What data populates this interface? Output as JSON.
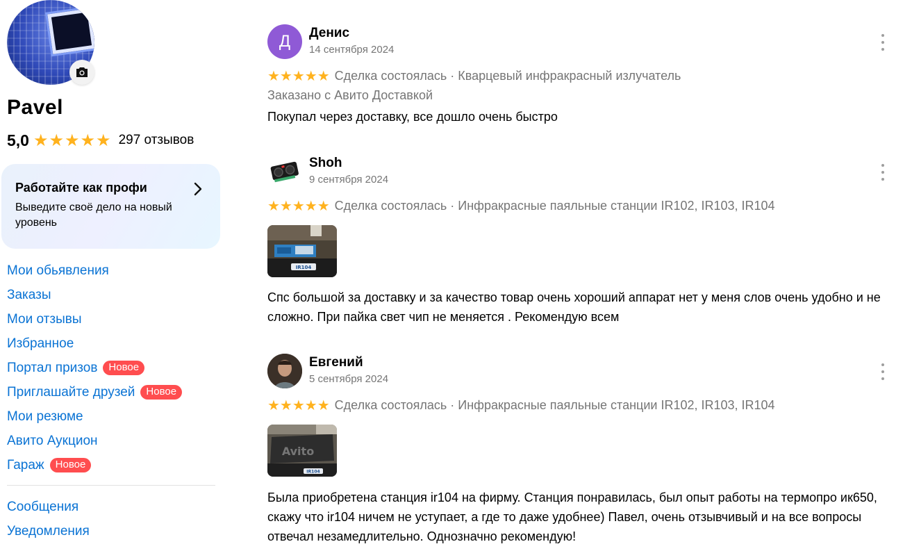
{
  "profile": {
    "name": "Pavel",
    "rating": "5,0",
    "stars": "★★★★★",
    "reviews_count": "297 отзывов"
  },
  "promo": {
    "title": "Работайте как профи",
    "subtitle": "Выведите своё дело на новый уровень"
  },
  "nav": {
    "items": [
      {
        "label": "Мои обьявления"
      },
      {
        "label": "Заказы"
      },
      {
        "label": "Мои отзывы"
      },
      {
        "label": "Избранное"
      },
      {
        "label": "Портал призов",
        "badge": "Новое"
      },
      {
        "label": "Приглашайте друзей",
        "badge": "Новое"
      },
      {
        "label": "Мои резюме"
      },
      {
        "label": "Авито Аукцион"
      },
      {
        "label": "Гараж",
        "badge": "Новое"
      }
    ],
    "secondary": [
      {
        "label": "Сообщения"
      },
      {
        "label": "Уведомления"
      }
    ]
  },
  "reviews": [
    {
      "avatar_letter": "Д",
      "author": "Денис",
      "date": "14 сентября 2024",
      "stars": "★★★★★",
      "meta": "Сделка состоялась · Кварцевый инфракрасный излучатель",
      "delivery": "Заказано с Авито Доставкой",
      "text": "Покупал через доставку, все дошло очень быстро"
    },
    {
      "author": "Shoh",
      "date": "9 сентября 2024",
      "stars": "★★★★★",
      "meta": "Сделка состоялась · Инфракрасные паяльные станции IR102, IR103, IR104",
      "photo_label": "IR104",
      "text": "Спс большой за доставку и за качество товар очень хороший аппарат нет у меня слов очень удобно и не сложно. При пайка свет чип не меняется . Рекомендую всем"
    },
    {
      "author": "Евгений",
      "date": "5 сентября 2024",
      "stars": "★★★★★",
      "meta": "Сделка состоялась · Инфракрасные паяльные станции IR102, IR103, IR104",
      "photo_label": "IR104",
      "photo_watermark": "Avito",
      "text": "Была приобретена станция ir104 на фирму. Станция понравилась, был опыт работы на термопро ик650, скажу что ir104 ничем не уступает, а где то даже удобнее) Павел, очень отзывчивый и на все вопросы отвечал незамедлительно. Однозначно рекомендую!"
    }
  ],
  "colors": {
    "link": "#0a73d4",
    "star": "#ffb21e",
    "badge": "#ff4d4f",
    "avatar_denis": "#8f5ad6",
    "muted": "#757575"
  }
}
